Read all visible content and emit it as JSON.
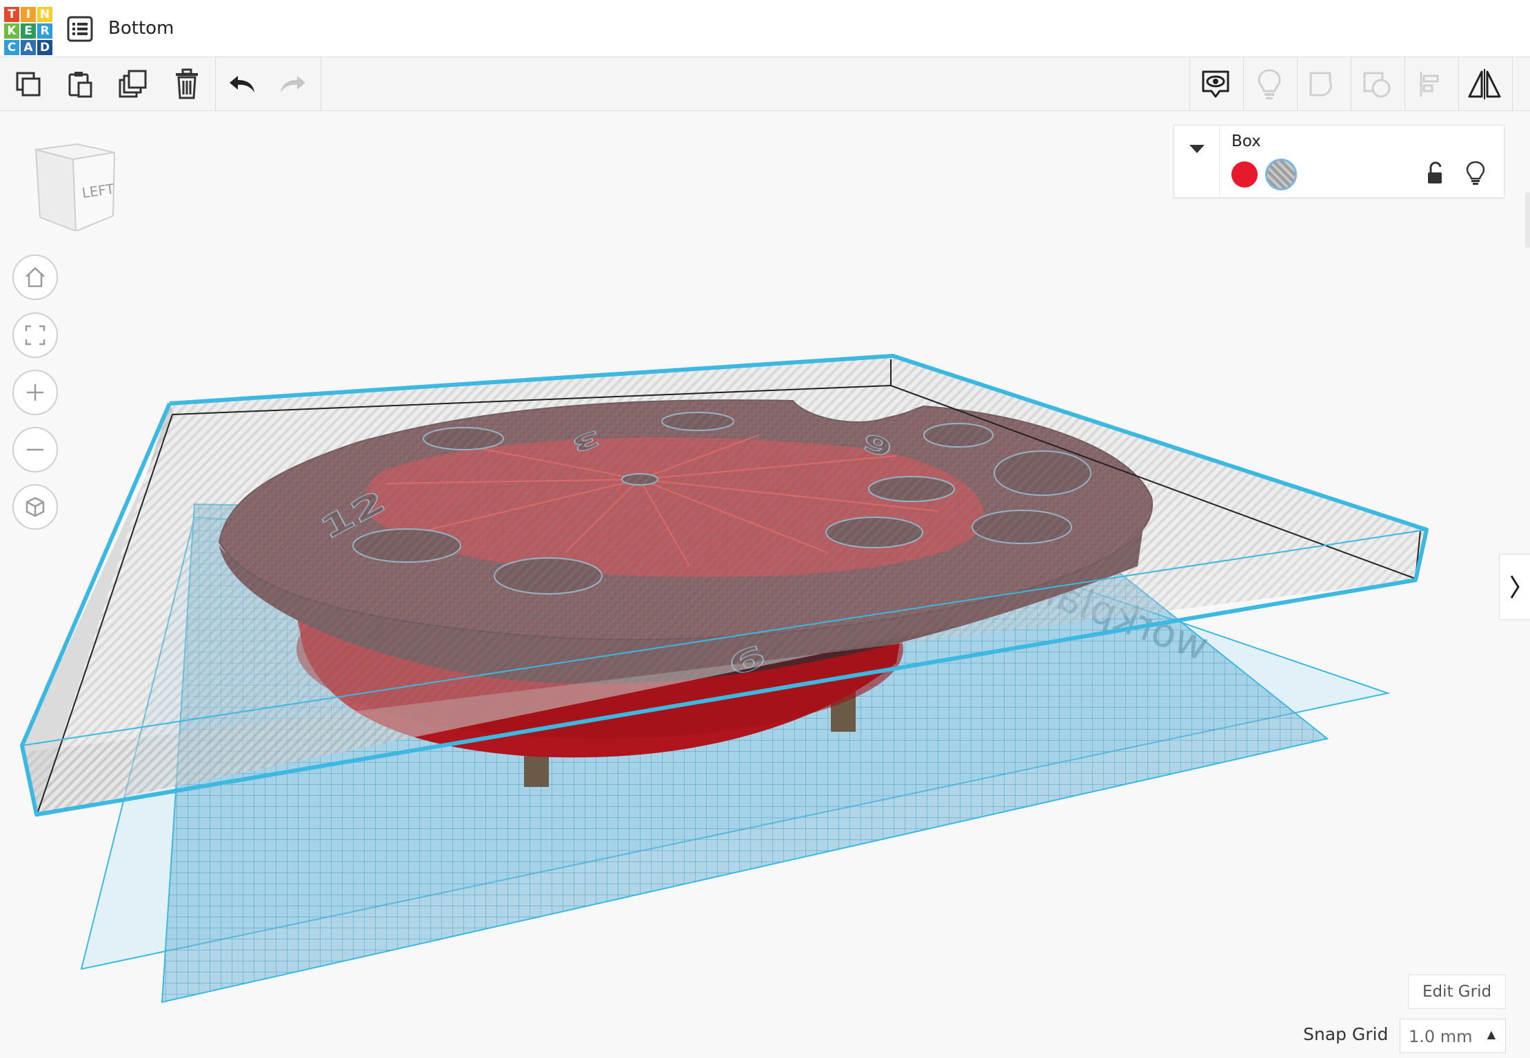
{
  "app": {
    "logo_letters": [
      "T",
      "I",
      "N",
      "K",
      "E",
      "R",
      "C",
      "A",
      "D"
    ],
    "logo_colors": [
      "#e2492f",
      "#f3a02b",
      "#f3cf2e",
      "#6dbb45",
      "#2c9b5d",
      "#2f9ed6",
      "#2f9ed6",
      "#2f6fb3",
      "#1d4f91"
    ],
    "document_title": "Bottom"
  },
  "toolbar": {
    "left_tools": [
      "copy-icon",
      "paste-icon",
      "duplicate-icon",
      "trash-icon",
      "undo-icon",
      "redo-icon"
    ],
    "right_tools": [
      "show-icon",
      "bulb-icon",
      "group-icon",
      "ungroup-icon",
      "align-icon",
      "mirror-icon"
    ]
  },
  "viewcube": {
    "face_label": "LEFT"
  },
  "inspector": {
    "title": "Box",
    "solid_color": "#e8192c",
    "hole_selected": true
  },
  "controls": {
    "edit_grid_label": "Edit Grid",
    "snap_grid_label": "Snap Grid",
    "snap_grid_value": "1.0 mm"
  },
  "scene": {
    "clock_numbers": [
      "12",
      "3",
      "6",
      "9"
    ],
    "workplane_watermark": "workplane"
  },
  "colors": {
    "accent_blue": "#3db8e0",
    "object_red": "#c2161f",
    "object_dark": "#5a2a2e"
  }
}
